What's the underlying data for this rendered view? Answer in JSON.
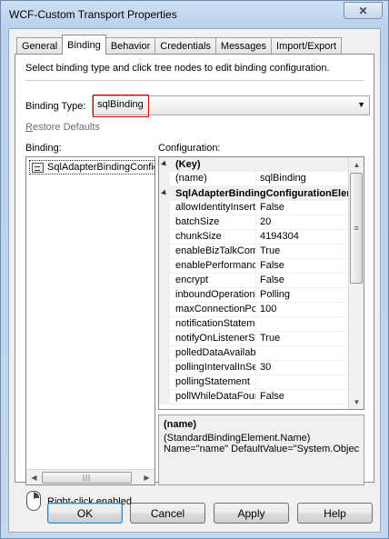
{
  "window": {
    "title": "WCF-Custom Transport Properties",
    "close_glyph": "✕"
  },
  "tabs": [
    {
      "label": "General",
      "active": false
    },
    {
      "label": "Binding",
      "active": true
    },
    {
      "label": "Behavior",
      "active": false
    },
    {
      "label": "Credentials",
      "active": false
    },
    {
      "label": "Messages",
      "active": false
    },
    {
      "label": "Import/Export",
      "active": false
    }
  ],
  "binding_tab": {
    "instructions": "Select binding type and click tree nodes to edit binding configuration.",
    "binding_type_label": "Binding Type:",
    "binding_type_value": "sqlBinding",
    "restore_defaults_first": "R",
    "restore_defaults_rest": "estore Defaults",
    "binding_label": "Binding:",
    "configuration_label": "Configuration:",
    "binding_items": [
      "SqlAdapterBindingConfig"
    ],
    "config": {
      "key_category": "(Key)",
      "key_rows": [
        {
          "name": "(name)",
          "value": "sqlBinding"
        }
      ],
      "element_category": "SqlAdapterBindingConfigurationEleme",
      "element_rows": [
        {
          "name": "allowIdentityInsert",
          "value": "False"
        },
        {
          "name": "batchSize",
          "value": "20"
        },
        {
          "name": "chunkSize",
          "value": "4194304"
        },
        {
          "name": "enableBizTalkCom",
          "value": "True"
        },
        {
          "name": "enablePerformanc",
          "value": "False"
        },
        {
          "name": "encrypt",
          "value": "False"
        },
        {
          "name": "inboundOperationT",
          "value": "Polling"
        },
        {
          "name": "maxConnectionPo",
          "value": "100"
        },
        {
          "name": "notificationStateme",
          "value": ""
        },
        {
          "name": "notifyOnListenerSt",
          "value": "True"
        },
        {
          "name": "polledDataAvailab",
          "value": ""
        },
        {
          "name": "pollingIntervalInSe",
          "value": "30"
        },
        {
          "name": "pollingStatement",
          "value": ""
        },
        {
          "name": "pollWhileDataFour",
          "value": "False"
        }
      ]
    },
    "description": {
      "title": "(name)",
      "line1": "(StandardBindingElement.Name)",
      "line2": "Name=\"name\" DefaultValue=\"System.Object\" ..."
    },
    "right_click_label": "Right-click enabled"
  },
  "buttons": {
    "ok": "OK",
    "cancel": "Cancel",
    "apply": "Apply",
    "help": "Help"
  },
  "scroll_glyphs": {
    "left": "◀",
    "right": "▶",
    "up": "▲",
    "down": "▼",
    "grip_h": "|||",
    "grip_v": "≡"
  }
}
